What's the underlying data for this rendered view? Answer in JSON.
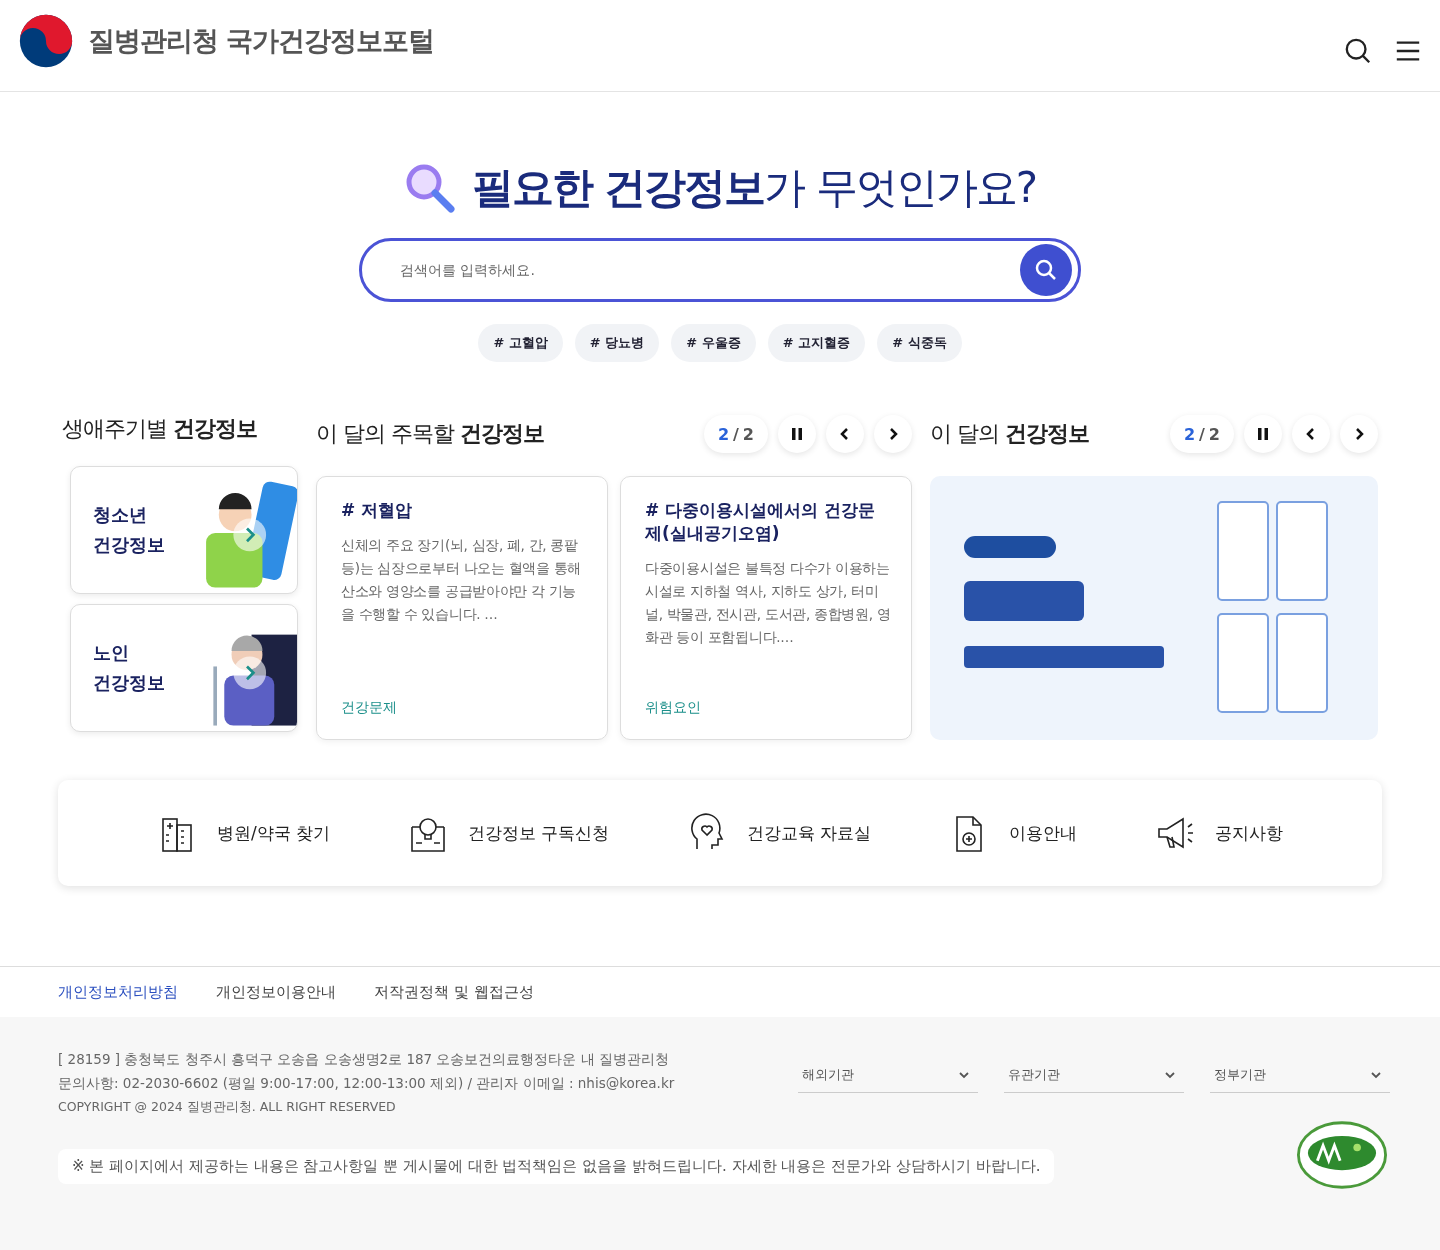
{
  "header": {
    "site_title": "질병관리청 국가건강정보포털"
  },
  "hero": {
    "title": "**필요한 건강정보**가 무엇인가요?",
    "search": {
      "placeholder": "검색어를 입력하세요."
    },
    "tags": [
      "# 고혈압",
      "# 당뇨병",
      "# 우울증",
      "# 고지혈증",
      "# 식중독"
    ]
  },
  "life_stage": {
    "heading": "생애주기별 **건강정보**",
    "cards": [
      {
        "label": "청소년\n건강정보"
      },
      {
        "label": "노인\n건강정보"
      }
    ]
  },
  "featured": {
    "heading": "이 달의 주목할 **건강정보**",
    "pager": {
      "current": "2",
      "separator": "/",
      "total": "2"
    },
    "cards": [
      {
        "title": "# 저혈압",
        "text": "신체의 주요 장기(뇌, 심장, 폐, 간, 콩팥 등)는 심장으로부터 나오는 혈액을 통해 산소와 영양소를 공급받아야만 각 기능을 수행할 수 있습니다. …",
        "category": "건강문제"
      },
      {
        "title": "# 다중이용시설에서의 건강문제(실내공기오염)",
        "text": "다중이용시설은 불특정 다수가 이용하는 시설로 지하철 역사, 지하도 상가, 터미널, 박물관, 전시관, 도서관, 종합병원, 영화관 등이 포함됩니다.…",
        "category": "위험요인"
      }
    ]
  },
  "monthly": {
    "heading": "이 달의 **건강정보**",
    "pager": {
      "current": "2",
      "separator": "/",
      "total": "2"
    }
  },
  "quick_menu": [
    "병원/약국 찾기",
    "건강정보 구독신청",
    "건강교육 자료실",
    "이용안내",
    "공지사항"
  ],
  "footer": {
    "links": [
      {
        "label": "개인정보처리방침",
        "selected": true
      },
      {
        "label": "개인정보이용안내",
        "selected": false
      },
      {
        "label": "저작권정책 및 웹접근성",
        "selected": false
      }
    ],
    "address": "[ 28159 ] 충청북도 청주시 흥덕구 오송읍 오송생명2로 187 오송보건의료행정타운 내 질병관리청",
    "contact": "문의사항: 02-2030-6602 (평일 9:00-17:00, 12:00-13:00 제외) / 관리자 이메일 : nhis@korea.kr",
    "copyright": "COPYRIGHT @ 2024 질병관리청. ALL RIGHT RESERVED",
    "selects": [
      "해외기관",
      "유관기관",
      "정부기관"
    ],
    "notice": "※ 본 페이지에서 제공하는 내용은 참고사항일 뿐 게시물에 대한 법적책임은 없음을 밝혀드립니다. 자세한 내용은 전문가와 상담하시기 바랍니다."
  }
}
